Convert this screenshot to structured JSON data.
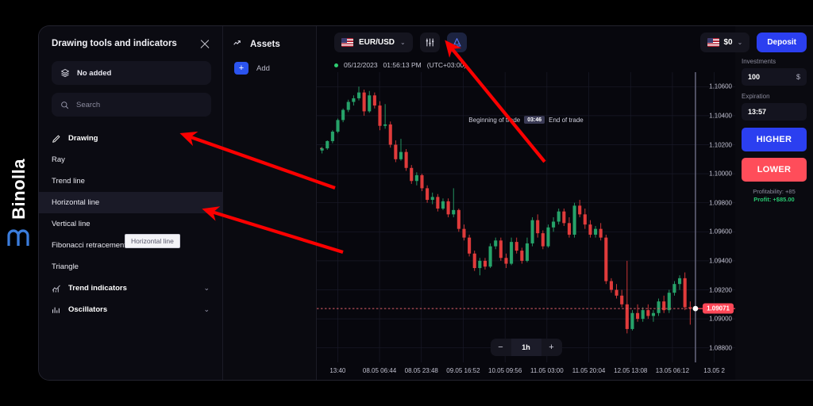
{
  "brand": {
    "name": "Binolla",
    "mark_icon": "binolla-logo-icon"
  },
  "tools_panel": {
    "title": "Drawing tools and indicators",
    "close_icon": "close-icon",
    "no_added": {
      "label": "No added",
      "icon": "layers-icon"
    },
    "search": {
      "placeholder": "Search",
      "value": "",
      "icon": "search-icon"
    },
    "items": [
      {
        "label": "Drawing",
        "icon": "pencil-icon",
        "type": "header"
      },
      {
        "label": "Ray",
        "type": "tool"
      },
      {
        "label": "Trend line",
        "type": "tool"
      },
      {
        "label": "Horizontal line",
        "type": "tool",
        "active": true
      },
      {
        "label": "Vertical line",
        "type": "tool"
      },
      {
        "label": "Fibonacci retracement",
        "type": "tool"
      },
      {
        "label": "Triangle",
        "type": "tool"
      },
      {
        "label": "Trend indicators",
        "icon": "trend-icon",
        "type": "group",
        "chevron": "⌄"
      },
      {
        "label": "Oscillators",
        "icon": "oscillator-icon",
        "type": "group",
        "chevron": "⌄"
      }
    ],
    "tooltip": "Horizontal line"
  },
  "assets_panel": {
    "title": "Assets",
    "icon": "assets-icon",
    "add_label": "Add",
    "add_icon": "plus-icon"
  },
  "chart_toolbar": {
    "pair": "EUR/USD",
    "pair_flag_icon": "eur-usd-flag-icon",
    "pair_caret": "⌄",
    "indicators_icon": "indicators-sliders-icon",
    "drawing_icon": "drawing-tools-icon"
  },
  "balance_bar": {
    "flag_icon": "us-flag-icon",
    "amount": "$0",
    "caret": "⌄",
    "deposit_label": "Deposit"
  },
  "chart_meta": {
    "status_icon": "live-dot-icon",
    "date": "05/12/2023",
    "time": "01:56:13 PM",
    "timezone": "(UTC+03:00)"
  },
  "trade_band": {
    "begin_label": "Beginning of trade",
    "countdown": "03:46",
    "end_label": "End of trade"
  },
  "trade_panel": {
    "investments_label": "Investments",
    "investments_value": "100",
    "currency_symbol": "$",
    "expiration_label": "Expiration",
    "expiration_value": "13:57",
    "higher_label": "HIGHER",
    "lower_label": "LOWER",
    "profitability_text": "Profitability: +85",
    "profit_text": "Profit: +$85.00"
  },
  "zoom_control": {
    "minus": "−",
    "value": "1h",
    "plus": "+"
  },
  "chart_data": {
    "type": "candlestick",
    "title": "EUR/USD",
    "xlabel": "",
    "ylabel": "",
    "ylim": [
      1.087,
      1.107
    ],
    "grid": true,
    "price_ticks": [
      "1.10600",
      "1.10400",
      "1.10200",
      "1.10000",
      "1.09800",
      "1.09600",
      "1.09400",
      "1.09200",
      "1.09000",
      "1.08800"
    ],
    "price_tick_values": [
      1.106,
      1.104,
      1.102,
      1.1,
      1.098,
      1.096,
      1.094,
      1.092,
      1.09,
      1.088
    ],
    "current_price": "1.09071",
    "current_price_value": 1.09071,
    "time_ticks": [
      "13:40",
      "08.05 06:44",
      "08.05 23:48",
      "09.05 16:52",
      "10.05 09:56",
      "11.05 03:00",
      "11.05 20:04",
      "12.05 13:08",
      "13.05 06:12",
      "13.05 2"
    ],
    "up_color": "#26a269",
    "down_color": "#e03b3b",
    "candles": [
      {
        "o": 1.1016,
        "h": 1.10185,
        "l": 1.1014,
        "c": 1.10175
      },
      {
        "o": 1.10175,
        "h": 1.1023,
        "l": 1.10165,
        "c": 1.10225
      },
      {
        "o": 1.10225,
        "h": 1.103,
        "l": 1.1021,
        "c": 1.1029
      },
      {
        "o": 1.1029,
        "h": 1.1038,
        "l": 1.1028,
        "c": 1.1037
      },
      {
        "o": 1.1037,
        "h": 1.1045,
        "l": 1.10355,
        "c": 1.1044
      },
      {
        "o": 1.1044,
        "h": 1.1051,
        "l": 1.10425,
        "c": 1.10495
      },
      {
        "o": 1.10495,
        "h": 1.1054,
        "l": 1.1047,
        "c": 1.1052
      },
      {
        "o": 1.1052,
        "h": 1.106,
        "l": 1.10505,
        "c": 1.1056
      },
      {
        "o": 1.1056,
        "h": 1.1058,
        "l": 1.104,
        "c": 1.1043
      },
      {
        "o": 1.1043,
        "h": 1.1057,
        "l": 1.1042,
        "c": 1.1054
      },
      {
        "o": 1.1054,
        "h": 1.1056,
        "l": 1.1045,
        "c": 1.1047
      },
      {
        "o": 1.1047,
        "h": 1.105,
        "l": 1.103,
        "c": 1.1033
      },
      {
        "o": 1.1033,
        "h": 1.1048,
        "l": 1.1031,
        "c": 1.1034
      },
      {
        "o": 1.1034,
        "h": 1.1036,
        "l": 1.1018,
        "c": 1.102
      },
      {
        "o": 1.102,
        "h": 1.1023,
        "l": 1.1008,
        "c": 1.101
      },
      {
        "o": 1.101,
        "h": 1.1024,
        "l": 1.1009,
        "c": 1.1015
      },
      {
        "o": 1.1015,
        "h": 1.1017,
        "l": 1.1002,
        "c": 1.1004
      },
      {
        "o": 1.1004,
        "h": 1.1006,
        "l": 1.0993,
        "c": 1.0995
      },
      {
        "o": 1.0995,
        "h": 1.1001,
        "l": 1.0992,
        "c": 1.0999
      },
      {
        "o": 1.0999,
        "h": 1.1,
        "l": 1.0988,
        "c": 1.099
      },
      {
        "o": 1.099,
        "h": 1.0992,
        "l": 1.098,
        "c": 1.0982
      },
      {
        "o": 1.0982,
        "h": 1.0987,
        "l": 1.0979,
        "c": 1.0984
      },
      {
        "o": 1.0984,
        "h": 1.0986,
        "l": 1.0974,
        "c": 1.0976
      },
      {
        "o": 1.0976,
        "h": 1.0983,
        "l": 1.0975,
        "c": 1.0981
      },
      {
        "o": 1.0981,
        "h": 1.0983,
        "l": 1.097,
        "c": 1.0972
      },
      {
        "o": 1.0972,
        "h": 1.099,
        "l": 1.097,
        "c": 1.0975
      },
      {
        "o": 1.0975,
        "h": 1.0976,
        "l": 1.096,
        "c": 1.0962
      },
      {
        "o": 1.0962,
        "h": 1.0965,
        "l": 1.0954,
        "c": 1.0956
      },
      {
        "o": 1.0956,
        "h": 1.0958,
        "l": 1.0943,
        "c": 1.0945
      },
      {
        "o": 1.0945,
        "h": 1.0947,
        "l": 1.0933,
        "c": 1.0935
      },
      {
        "o": 1.0935,
        "h": 1.0942,
        "l": 1.093,
        "c": 1.094
      },
      {
        "o": 1.094,
        "h": 1.0942,
        "l": 1.0934,
        "c": 1.0936
      },
      {
        "o": 1.0936,
        "h": 1.0952,
        "l": 1.0935,
        "c": 1.095
      },
      {
        "o": 1.095,
        "h": 1.0956,
        "l": 1.0948,
        "c": 1.0954
      },
      {
        "o": 1.0954,
        "h": 1.0956,
        "l": 1.094,
        "c": 1.0942
      },
      {
        "o": 1.0942,
        "h": 1.0945,
        "l": 1.0935,
        "c": 1.0938
      },
      {
        "o": 1.0938,
        "h": 1.0956,
        "l": 1.0937,
        "c": 1.0953
      },
      {
        "o": 1.0953,
        "h": 1.0956,
        "l": 1.0945,
        "c": 1.0947
      },
      {
        "o": 1.0947,
        "h": 1.0949,
        "l": 1.0938,
        "c": 1.094
      },
      {
        "o": 1.094,
        "h": 1.0956,
        "l": 1.0939,
        "c": 1.0952
      },
      {
        "o": 1.0952,
        "h": 1.097,
        "l": 1.095,
        "c": 1.0968
      },
      {
        "o": 1.0968,
        "h": 1.0972,
        "l": 1.0956,
        "c": 1.0959
      },
      {
        "o": 1.0959,
        "h": 1.0961,
        "l": 1.0948,
        "c": 1.095
      },
      {
        "o": 1.095,
        "h": 1.0965,
        "l": 1.0949,
        "c": 1.0963
      },
      {
        "o": 1.0963,
        "h": 1.097,
        "l": 1.096,
        "c": 1.0967
      },
      {
        "o": 1.0967,
        "h": 1.0976,
        "l": 1.0965,
        "c": 1.0974
      },
      {
        "o": 1.0974,
        "h": 1.0976,
        "l": 1.0964,
        "c": 1.0966
      },
      {
        "o": 1.0966,
        "h": 1.097,
        "l": 1.0956,
        "c": 1.0958
      },
      {
        "o": 1.0958,
        "h": 1.098,
        "l": 1.0956,
        "c": 1.0978
      },
      {
        "o": 1.0978,
        "h": 1.0982,
        "l": 1.097,
        "c": 1.0972
      },
      {
        "o": 1.0972,
        "h": 1.0976,
        "l": 1.0962,
        "c": 1.0965
      },
      {
        "o": 1.0965,
        "h": 1.0968,
        "l": 1.0956,
        "c": 1.0958
      },
      {
        "o": 1.0958,
        "h": 1.0964,
        "l": 1.0956,
        "c": 1.0962
      },
      {
        "o": 1.0962,
        "h": 1.0966,
        "l": 1.0954,
        "c": 1.0956
      },
      {
        "o": 1.0956,
        "h": 1.0958,
        "l": 1.0924,
        "c": 1.0926
      },
      {
        "o": 1.0926,
        "h": 1.0928,
        "l": 1.0918,
        "c": 1.092
      },
      {
        "o": 1.092,
        "h": 1.0924,
        "l": 1.0914,
        "c": 1.0916
      },
      {
        "o": 1.0916,
        "h": 1.092,
        "l": 1.0908,
        "c": 1.091
      },
      {
        "o": 1.091,
        "h": 1.094,
        "l": 1.089,
        "c": 1.0893
      },
      {
        "o": 1.0893,
        "h": 1.0906,
        "l": 1.0892,
        "c": 1.0904
      },
      {
        "o": 1.0904,
        "h": 1.091,
        "l": 1.0898,
        "c": 1.09
      },
      {
        "o": 1.09,
        "h": 1.0908,
        "l": 1.0898,
        "c": 1.0906
      },
      {
        "o": 1.0906,
        "h": 1.091,
        "l": 1.09,
        "c": 1.0902
      },
      {
        "o": 1.0902,
        "h": 1.0906,
        "l": 1.0898,
        "c": 1.0904
      },
      {
        "o": 1.0904,
        "h": 1.0914,
        "l": 1.0902,
        "c": 1.0912
      },
      {
        "o": 1.0912,
        "h": 1.0916,
        "l": 1.0904,
        "c": 1.0906
      },
      {
        "o": 1.0906,
        "h": 1.092,
        "l": 1.0904,
        "c": 1.0918
      },
      {
        "o": 1.0918,
        "h": 1.0926,
        "l": 1.0916,
        "c": 1.0924
      },
      {
        "o": 1.0924,
        "h": 1.093,
        "l": 1.092,
        "c": 1.0928
      },
      {
        "o": 1.0928,
        "h": 1.0932,
        "l": 1.0906,
        "c": 1.0908
      },
      {
        "o": 1.0908,
        "h": 1.0912,
        "l": 1.0896,
        "c": 1.09071
      }
    ]
  }
}
